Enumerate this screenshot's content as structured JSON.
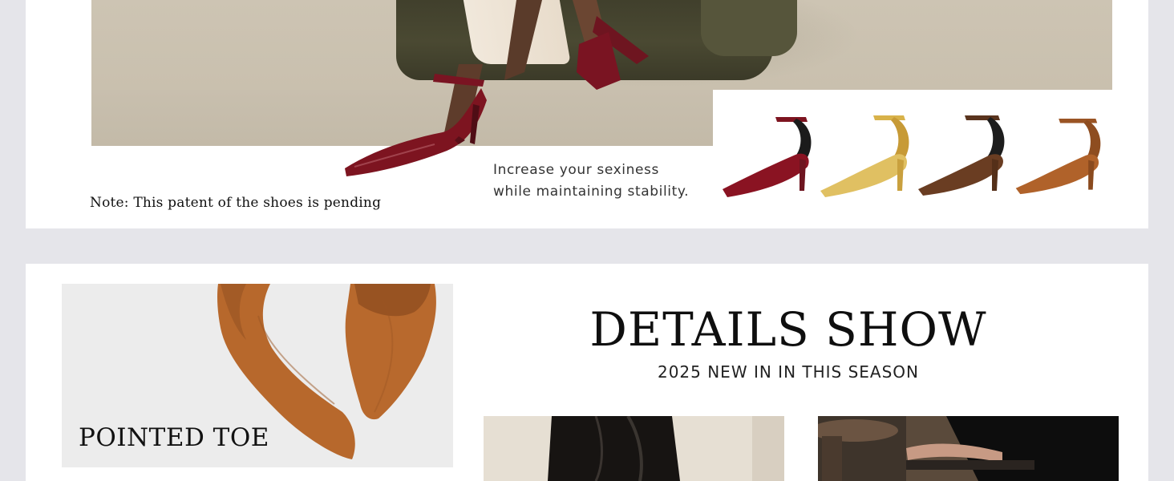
{
  "top_section": {
    "note": "Note: This patent of the shoes is pending",
    "tagline_line1": "Increase your sexiness",
    "tagline_line2": "while maintaining stability.",
    "variants": [
      {
        "name": "burgundy-patent",
        "color": "#7d1420"
      },
      {
        "name": "gold-metallic",
        "color": "#d8b24a"
      },
      {
        "name": "brown-suede",
        "color": "#6a3d22"
      },
      {
        "name": "camel-leather",
        "color": "#b0622a"
      }
    ]
  },
  "details_section": {
    "feature_label": "POINTED TOE",
    "heading": "DETAILS SHOW",
    "subheading": "2025 NEW IN IN THIS SEASON",
    "feature_shoe_color": "#b7682c"
  },
  "colors": {
    "page_bg": "#e5e5ea",
    "panel_bg": "#ffffff",
    "feature_bg": "#ececec"
  }
}
